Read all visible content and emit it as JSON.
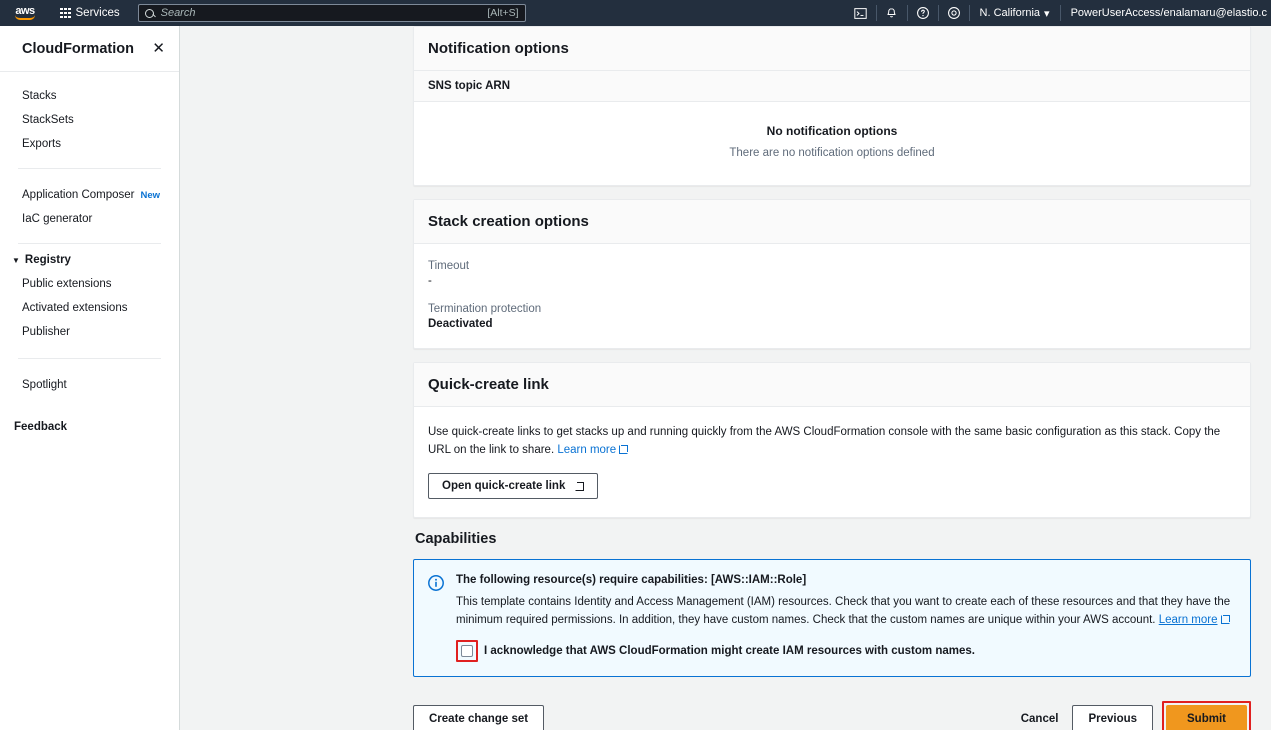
{
  "topnav": {
    "logo_text": "aws",
    "services_label": "Services",
    "search": {
      "placeholder": "Search",
      "shortcut": "[Alt+S]"
    },
    "icons": [
      "cloudshell-icon",
      "notifications-bell-icon",
      "help-question-icon",
      "settings-gear-icon"
    ],
    "region_label": "N. California",
    "region_caret": "▾",
    "account_label": "PowerUserAccess/enalamaru@elastio.c"
  },
  "sidebar": {
    "title": "CloudFormation",
    "close_icon_label": "✕",
    "group1": [
      {
        "label": "Stacks"
      },
      {
        "label": "StackSets"
      },
      {
        "label": "Exports"
      }
    ],
    "group2": [
      {
        "label": "Application Composer",
        "badge": "New"
      },
      {
        "label": "IaC generator",
        "badge": ""
      }
    ],
    "registry": {
      "caret": "▼",
      "label": "Registry",
      "items": [
        {
          "label": "Public extensions"
        },
        {
          "label": "Activated extensions"
        },
        {
          "label": "Publisher"
        }
      ]
    },
    "group4": [
      {
        "label": "Spotlight"
      }
    ],
    "feedback_label": "Feedback"
  },
  "main": {
    "notification_card": {
      "title": "Notification options",
      "sub_header": "SNS topic ARN",
      "empty_title": "No notification options",
      "empty_sub": "There are no notification options defined"
    },
    "stack_creation_card": {
      "title": "Stack creation options",
      "timeout_label": "Timeout",
      "timeout_value": "-",
      "termination_label": "Termination protection",
      "termination_value": "Deactivated"
    },
    "quick_create_card": {
      "title": "Quick-create link",
      "description": "Use quick-create links to get stacks up and running quickly from the AWS CloudFormation console with the same basic configuration as this stack. Copy the URL on the link to share.",
      "learn_more": "Learn more",
      "button_label": "Open quick-create link"
    },
    "capabilities": {
      "heading": "Capabilities",
      "alert_title": "The following resource(s) require capabilities: [AWS::IAM::Role]",
      "alert_body": "This template contains Identity and Access Management (IAM) resources. Check that you want to create each of these resources and that they have the minimum required permissions. In addition, they have custom names. Check that the custom names are unique within your AWS account.",
      "alert_learn_more": "Learn more",
      "acknowledge_label": "I acknowledge that AWS CloudFormation might create IAM resources with custom names.",
      "acknowledge_checked": false
    },
    "footer": {
      "create_change_set": "Create change set",
      "cancel": "Cancel",
      "previous": "Previous",
      "submit": "Submit"
    }
  },
  "colors": {
    "nav_background": "#232f3e",
    "page_background": "#f2f3f3",
    "link": "#0972d3",
    "primary_button": "#f0971e",
    "highlight_annotation": "#e02020",
    "alert_background": "#f1faff"
  }
}
